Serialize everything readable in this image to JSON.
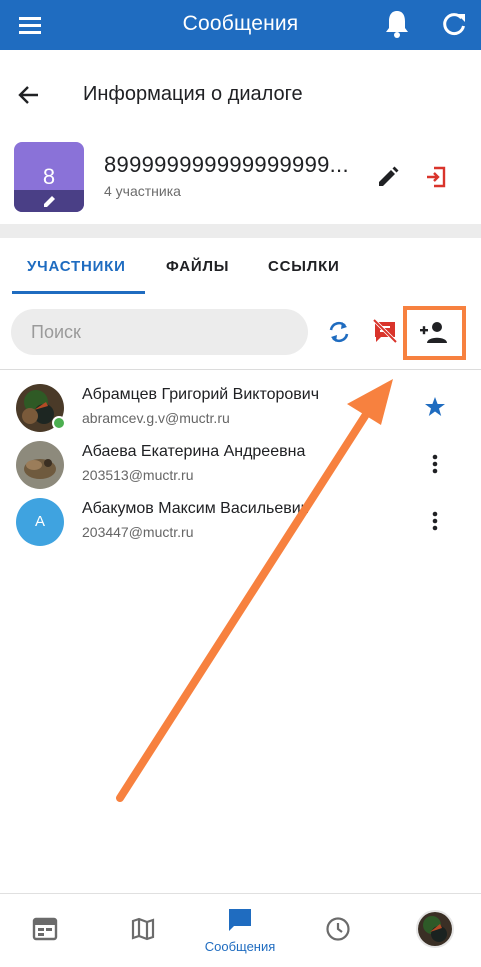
{
  "appbar": {
    "title": "Сообщения",
    "icons": {
      "menu": "menu-icon",
      "bell": "bell-icon",
      "refresh": "refresh-icon"
    },
    "color": "#1f6cc0"
  },
  "subheader": {
    "title": "Информация о диалоге",
    "back_icon": "arrow-back-icon"
  },
  "dialog": {
    "avatar_number": "8",
    "name": "899999999999999999...",
    "participants": "4 участника",
    "avatar_color": "#8a72d8",
    "actions": {
      "edit": "edit-icon",
      "leave": "exit-icon"
    }
  },
  "tabs": [
    {
      "label": "УЧАСТНИКИ",
      "active": true
    },
    {
      "label": "ФАЙЛЫ",
      "active": false
    },
    {
      "label": "ССЫЛКИ",
      "active": false
    }
  ],
  "search": {
    "placeholder": "Поиск",
    "value": ""
  },
  "toolbar": {
    "sync_icon": "sync-icon",
    "mute_icon": "no-chat-icon",
    "add_icon": "add-user-icon",
    "highlight_color": "#f7813f"
  },
  "members": [
    {
      "name": "Абрамцев Григорий Викторович",
      "email": "abramcev.g.v@muctr.ru",
      "online": true,
      "action": "star-icon"
    },
    {
      "name": "Абаева Екатерина Андреевна",
      "email": "203513@muctr.ru",
      "online": false,
      "action": "more-vert-icon"
    },
    {
      "name": "Абакумов Максим Васильевич",
      "email": "203447@muctr.ru",
      "online": false,
      "avatar_letter": "А",
      "action": "more-vert-icon"
    }
  ],
  "bottom_nav": {
    "items": [
      {
        "icon": "calendar-icon"
      },
      {
        "icon": "map-icon"
      },
      {
        "icon": "chat-icon",
        "label": "Сообщения",
        "active": true
      },
      {
        "icon": "clock-icon"
      },
      {
        "icon": "profile-avatar"
      }
    ]
  }
}
